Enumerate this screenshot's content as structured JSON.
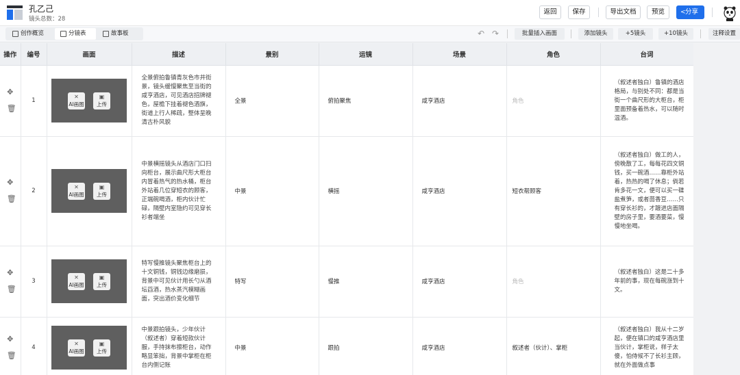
{
  "header": {
    "project_title": "孔乙己",
    "shot_count_label": "镜头总数：28",
    "buttons": {
      "back": "返回",
      "save": "保存",
      "export_doc": "导出文档",
      "preview": "预览",
      "share": "分享"
    }
  },
  "toolbar": {
    "tabs": [
      "创作概览",
      "分镜表",
      "故事板"
    ],
    "active_tab": "分镜表",
    "undo_icon": "↶",
    "redo_icon": "↷",
    "batch_insert": "批量插入画面",
    "add_shot": "添加镜头",
    "add_5": "+5镜头",
    "add_10": "+10镜头",
    "annotation_settings": "注释设置"
  },
  "table": {
    "headers": [
      "操作",
      "编号",
      "画面",
      "描述",
      "景别",
      "运镜",
      "场景",
      "角色",
      "台词"
    ],
    "frame_buttons": {
      "ai": "AI画图",
      "upload": "上传"
    },
    "role_placeholder": "角色",
    "rows": [
      {
        "num": "1",
        "desc": "全景俯拍鲁镇青灰色市井街景，镜头缓慢聚焦至当街的咸亨酒店，可见酒店招牌褪色，屋檐下挂着褪色酒旗，街道上行人稀疏，整体呈晚清古朴风貌",
        "shot": "全景",
        "move": "俯拍聚焦",
        "scene": "咸亨酒店",
        "role": "",
        "line": "（叙述者独白）鲁镇的酒店格局，与别处不同：都是当街一个曲尺形的大柜台，柜里面预备着热水，可以随时温酒。"
      },
      {
        "num": "2",
        "desc": "中景横摇镜头从酒店门口扫向柜台，展示曲尺形大柜台内冒着热气的热水桶，柜台外站着几位穿短衣的顾客，正端碗喝酒，柜内伙计忙碌，隔壁内室隐约可见穿长衫者端坐",
        "shot": "中景",
        "move": "横摇",
        "scene": "咸亨酒店",
        "role": "短衣帮顾客",
        "line": "（叙述者独白）做工的人，傍晚散了工，每每花四文铜钱，买一碗酒……靠柜外站着，热热的喝了休息；倘若肯多花一文，便可以买一碟盐煮笋，或者茴香豆……只有穿长衫的，才踱进店面隔壁的房子里，要酒要菜，慢慢地坐喝。"
      },
      {
        "num": "3",
        "desc": "特写慢推镜头聚焦柜台上的十文铜钱，铜钱边缘磨损，背景中可见伙计用长勺从酒坛舀酒，热水蒸汽模糊画面，突出酒价变化细节",
        "shot": "特写",
        "move": "慢推",
        "scene": "咸亨酒店",
        "role": "",
        "line": "（叙述者独白）这是二十多年前的事，现在每碗涨到十文。"
      },
      {
        "num": "4",
        "desc": "中景跟拍镜头，少年伙计（叙述者）穿着短款伙计服，手持抹布擦柜台，动作略显笨拙，背景中掌柜在柜台内侧记账",
        "shot": "中景",
        "move": "跟拍",
        "scene": "咸亨酒店",
        "role": "叙述者（伙计）、掌柜",
        "line": "（叙述者独白）我从十二岁起，便在镇口的咸亨酒店里当伙计，掌柜说，样子太傻，怕侍候不了长衫主顾，就在外面做点事"
      }
    ]
  },
  "colors": {
    "accent": "#1f6feb",
    "frame_bg": "#5f5f5f"
  }
}
